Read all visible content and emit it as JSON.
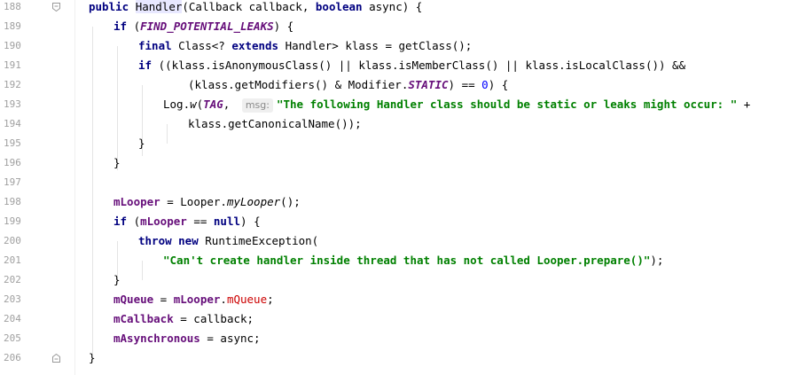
{
  "editor": {
    "lines": [
      {
        "num": "188",
        "tokens": [
          {
            "t": "public ",
            "c": "kw"
          },
          {
            "t": "Handler",
            "c": "hl"
          },
          {
            "t": "(Callback callback, "
          },
          {
            "t": "boolean ",
            "c": "kw"
          },
          {
            "t": "async) {"
          }
        ]
      },
      {
        "num": "189",
        "tokens": [
          {
            "t": "if ",
            "c": "kw"
          },
          {
            "t": "("
          },
          {
            "t": "FIND_POTENTIAL_LEAKS",
            "c": "field ital"
          },
          {
            "t": ") {"
          }
        ]
      },
      {
        "num": "190",
        "tokens": [
          {
            "t": "final ",
            "c": "kw"
          },
          {
            "t": "Class<? "
          },
          {
            "t": "extends ",
            "c": "kw"
          },
          {
            "t": "Handler> klass = getClass();"
          }
        ]
      },
      {
        "num": "191",
        "tokens": [
          {
            "t": "if ",
            "c": "kw"
          },
          {
            "t": "((klass.isAnonymousClass() || klass.isMemberClass() || klass.isLocalClass()) &&"
          }
        ]
      },
      {
        "num": "192",
        "tokens": [
          {
            "t": "(klass.getModifiers() & Modifier."
          },
          {
            "t": "STATIC",
            "c": "field ital"
          },
          {
            "t": ") == "
          },
          {
            "t": "0",
            "c": "num"
          },
          {
            "t": ") {"
          }
        ]
      },
      {
        "num": "193",
        "tokens": [
          {
            "t": "Log."
          },
          {
            "t": "w",
            "c": "ital"
          },
          {
            "t": "("
          },
          {
            "t": "TAG",
            "c": "field ital"
          },
          {
            "t": ", "
          },
          {
            "t": "msg:",
            "c": "hint"
          },
          {
            "t": "\"The following Handler class should be static or leaks might occur: \"",
            "c": "str"
          },
          {
            "t": " +"
          }
        ]
      },
      {
        "num": "194",
        "tokens": [
          {
            "t": "klass.getCanonicalName());"
          }
        ]
      },
      {
        "num": "195",
        "tokens": [
          {
            "t": "}"
          }
        ]
      },
      {
        "num": "196",
        "tokens": [
          {
            "t": "}"
          }
        ]
      },
      {
        "num": "197",
        "tokens": []
      },
      {
        "num": "198",
        "tokens": [
          {
            "t": "mLooper",
            "c": "field"
          },
          {
            "t": " = Looper."
          },
          {
            "t": "myLooper",
            "c": "ital"
          },
          {
            "t": "();"
          }
        ]
      },
      {
        "num": "199",
        "tokens": [
          {
            "t": "if ",
            "c": "kw"
          },
          {
            "t": "("
          },
          {
            "t": "mLooper",
            "c": "field"
          },
          {
            "t": " == "
          },
          {
            "t": "null",
            "c": "kw"
          },
          {
            "t": ") {"
          }
        ]
      },
      {
        "num": "200",
        "tokens": [
          {
            "t": "throw new ",
            "c": "kw"
          },
          {
            "t": "RuntimeException("
          }
        ]
      },
      {
        "num": "201",
        "tokens": [
          {
            "t": "\"Can't create handler inside thread that has not called Looper.prepare()\"",
            "c": "str"
          },
          {
            "t": ");"
          }
        ]
      },
      {
        "num": "202",
        "tokens": [
          {
            "t": "}"
          }
        ]
      },
      {
        "num": "203",
        "tokens": [
          {
            "t": "mQueue",
            "c": "field"
          },
          {
            "t": " = "
          },
          {
            "t": "mLooper",
            "c": "field"
          },
          {
            "t": "."
          },
          {
            "t": "mQueue",
            "c": "red"
          },
          {
            "t": ";"
          }
        ]
      },
      {
        "num": "204",
        "tokens": [
          {
            "t": "mCallback",
            "c": "field"
          },
          {
            "t": " = callback;"
          }
        ]
      },
      {
        "num": "205",
        "tokens": [
          {
            "t": "mAsynchronous",
            "c": "field"
          },
          {
            "t": " = async;"
          }
        ]
      },
      {
        "num": "206",
        "tokens": [
          {
            "t": "}"
          }
        ]
      }
    ]
  }
}
